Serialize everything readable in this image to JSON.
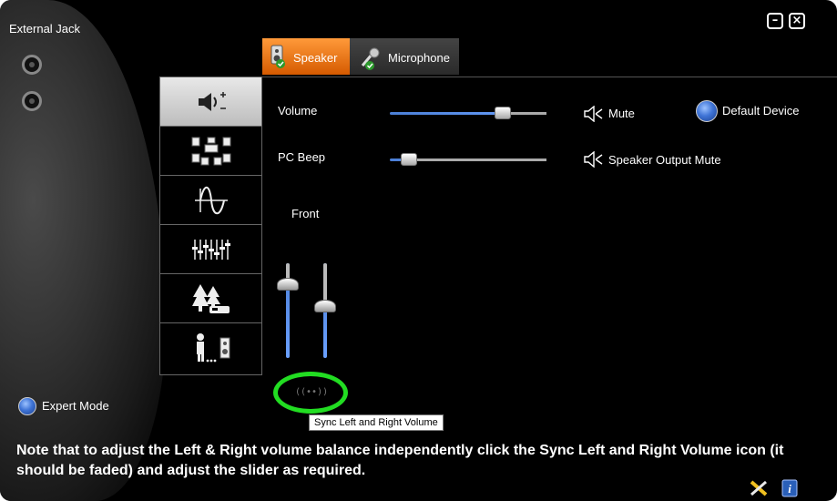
{
  "window": {
    "title": "External Jack",
    "minimize_glyph": "–",
    "close_glyph": "×"
  },
  "tabs": [
    {
      "label": "Speaker",
      "icon": "speaker-icon",
      "active": true
    },
    {
      "label": "Microphone",
      "icon": "microphone-icon",
      "active": false
    }
  ],
  "sidebar": {
    "expert_mode_label": "Expert Mode",
    "icons": [
      "volume-icon",
      "speaker-config-icon",
      "sound-effects-icon",
      "equalizer-icon",
      "environment-icon",
      "room-correction-icon"
    ]
  },
  "controls": {
    "volume_label": "Volume",
    "volume_level": 0.72,
    "pc_beep_label": "PC Beep",
    "pc_beep_level": 0.12,
    "mute_label": "Mute",
    "speaker_output_mute_label": "Speaker Output Mute",
    "default_device_label": "Default Device",
    "front_label": "Front",
    "left_level": 0.78,
    "right_level": 0.55,
    "sync_glyph": "((••))"
  },
  "tooltip": "Sync Left and Right Volume",
  "note": "Note that to adjust the Left & Right volume balance independently click the Sync Left and Right Volume icon (it should be faded) and adjust the slider as required.",
  "colors": {
    "accent_orange": "#e8700a",
    "slider_blue": "#4b7fd6",
    "highlight_green": "#22dd22"
  }
}
